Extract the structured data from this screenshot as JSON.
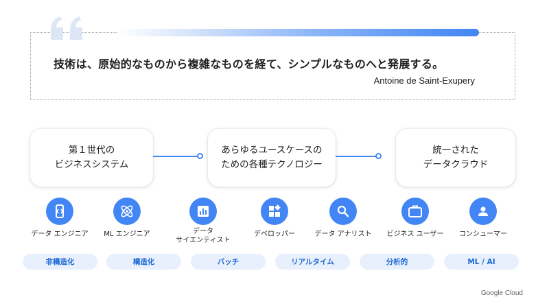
{
  "quote": {
    "text": "技術は、原始的なものから複雑なものを経て、シンプルなものへと発展する。",
    "author": "Antoine de Saint-Exupery"
  },
  "stages": [
    {
      "line1": "第１世代の",
      "line2": "ビジネスシステム"
    },
    {
      "line1": "あらゆるユースケースの",
      "line2": "ための各種テクノロジー"
    },
    {
      "line1": "統一された",
      "line2": "データクラウド"
    }
  ],
  "roles": [
    {
      "line1": "データ エンジニア",
      "line2": "",
      "icon": "code-bracket-icon"
    },
    {
      "line1": "ML エンジニア",
      "line2": "",
      "icon": "atom-icon"
    },
    {
      "line1": "データ",
      "line2": "サイエンティスト",
      "icon": "bar-chart-icon"
    },
    {
      "line1": "デベロッパー",
      "line2": "",
      "icon": "widgets-icon"
    },
    {
      "line1": "データ アナリスト",
      "line2": "",
      "icon": "search-icon"
    },
    {
      "line1": "ビジネス ユーザー",
      "line2": "",
      "icon": "briefcase-icon"
    },
    {
      "line1": "コンシューマー",
      "line2": "",
      "icon": "person-icon"
    }
  ],
  "pills": [
    "非構造化",
    "構造化",
    "バッチ",
    "リアルタイム",
    "分析的",
    "ML / AI"
  ],
  "logo": "Google Cloud",
  "colors": {
    "accent": "#4285f4",
    "pill_bg": "#e8f0fe",
    "pill_text": "#1967d2",
    "quote_mark": "#dce6f5"
  }
}
